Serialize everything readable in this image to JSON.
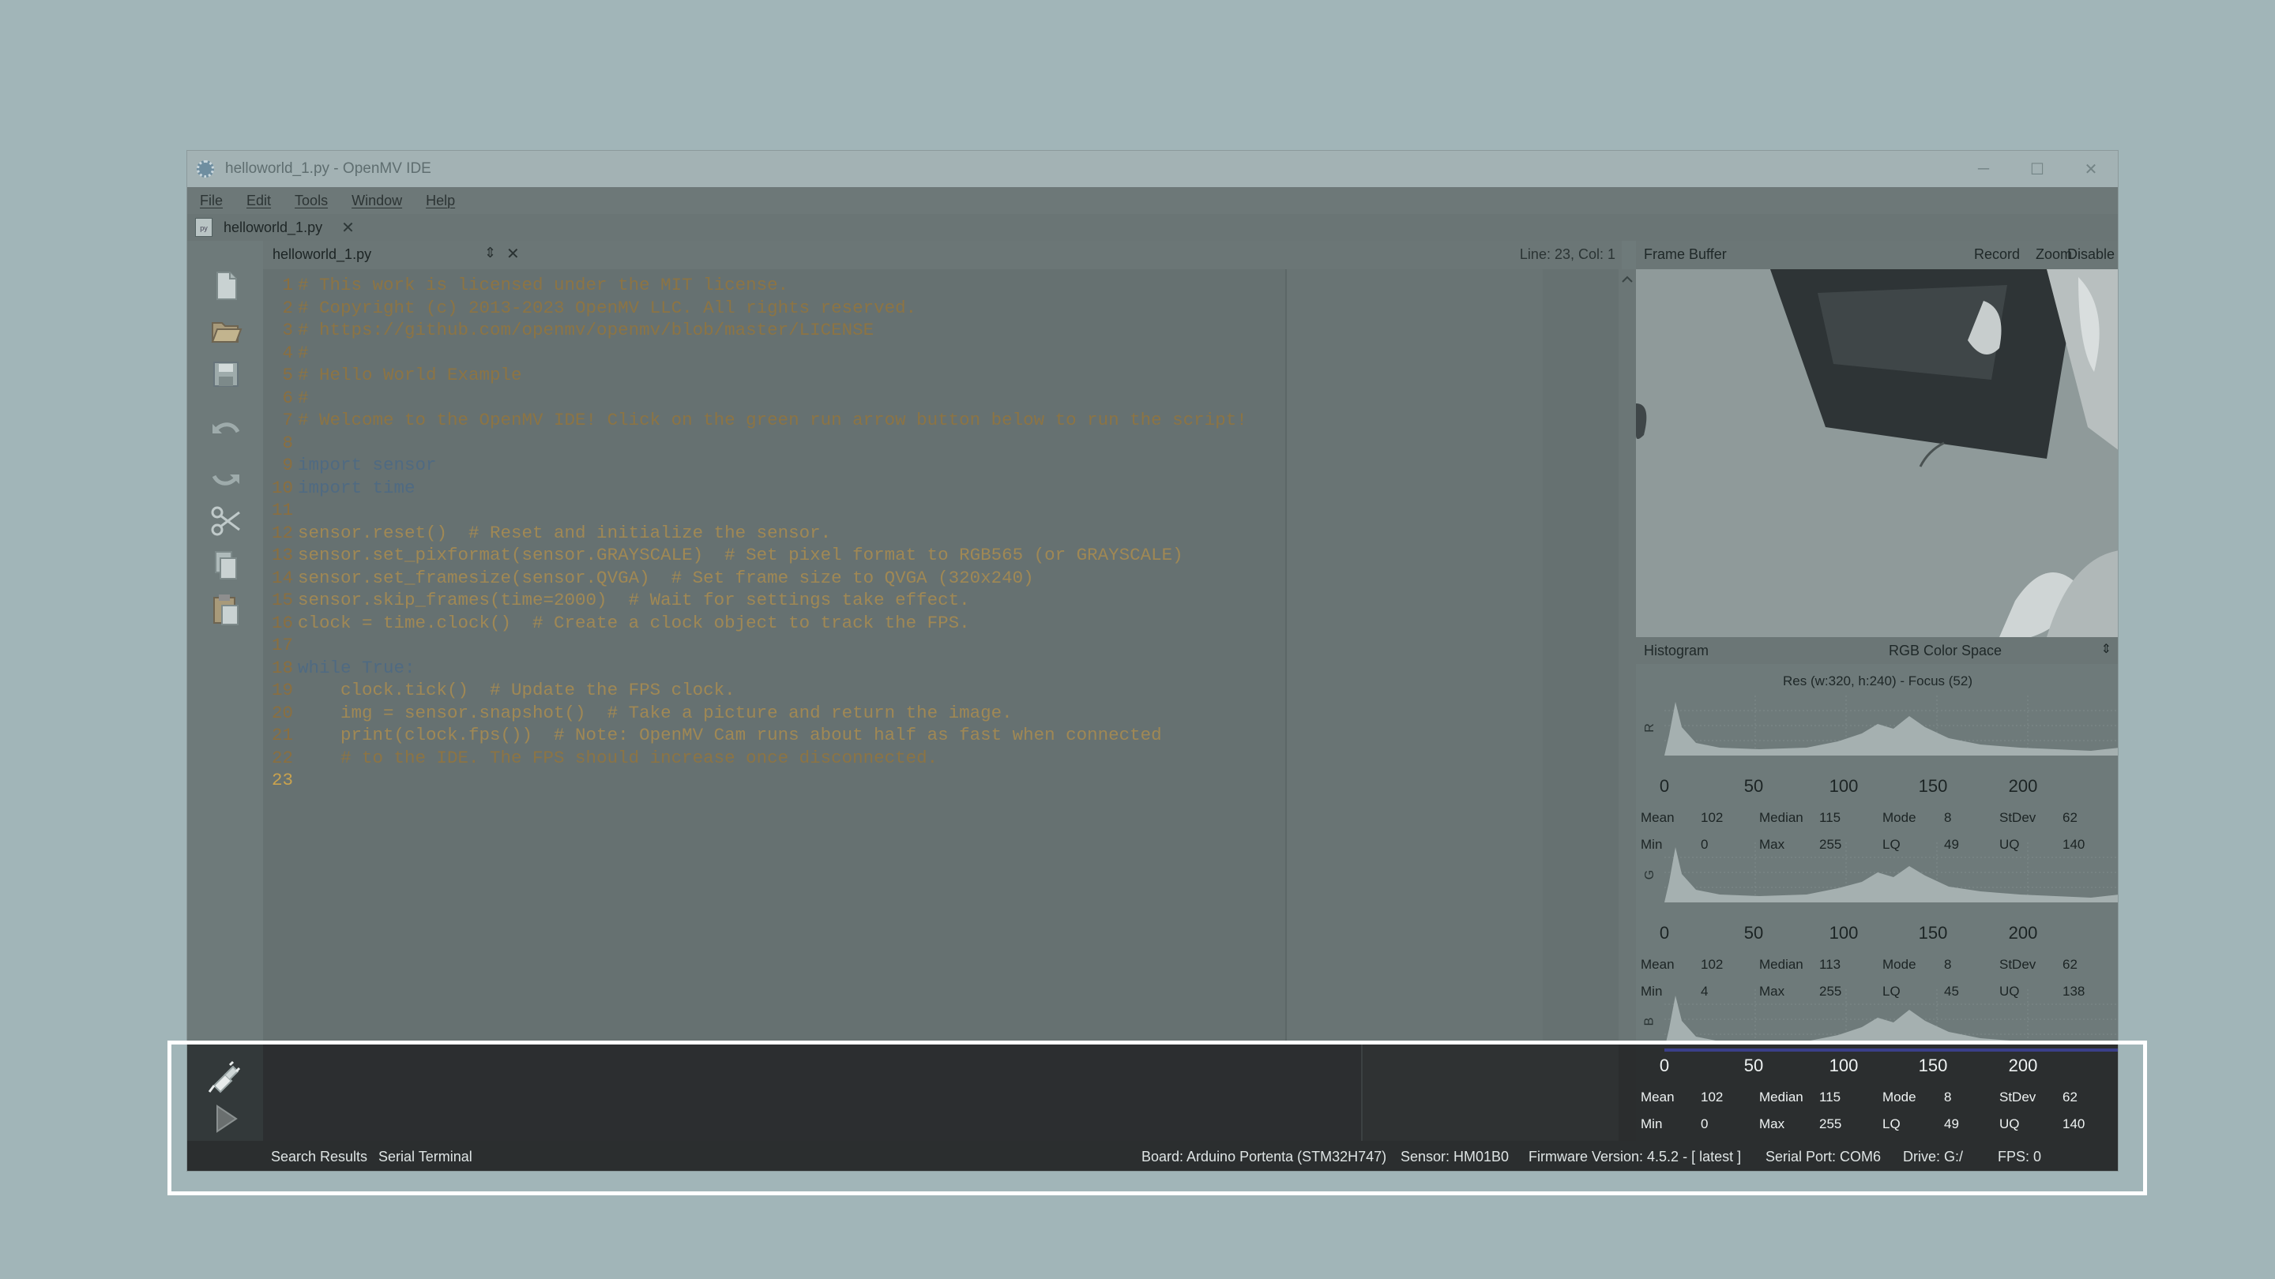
{
  "window": {
    "title": "helloworld_1.py - OpenMV IDE",
    "controls": [
      "─",
      "☐",
      "✕"
    ]
  },
  "menu": [
    "File",
    "Edit",
    "Tools",
    "Window",
    "Help"
  ],
  "file_tab": {
    "name": "helloworld_1.py",
    "close": "✕"
  },
  "editor": {
    "file_name": "helloworld_1.py",
    "arrows": "⇕",
    "close": "✕",
    "cursor_position": "Line: 23, Col: 1",
    "lines": [
      {
        "n": "1",
        "text": "# This work is licensed under the MIT license."
      },
      {
        "n": "2",
        "text": "# Copyright (c) 2013-2023 OpenMV LLC. All rights reserved."
      },
      {
        "n": "3",
        "text": "# https://github.com/openmv/openmv/blob/master/LICENSE"
      },
      {
        "n": "4",
        "text": "#"
      },
      {
        "n": "5",
        "text": "# Hello World Example"
      },
      {
        "n": "6",
        "text": "#"
      },
      {
        "n": "7",
        "text": "# Welcome to the OpenMV IDE! Click on the green run arrow button below to run the script!"
      },
      {
        "n": "8",
        "text": ""
      },
      {
        "n": "9",
        "text": "import sensor"
      },
      {
        "n": "10",
        "text": "import time"
      },
      {
        "n": "11",
        "text": ""
      },
      {
        "n": "12",
        "text": "sensor.reset()  # Reset and initialize the sensor."
      },
      {
        "n": "13",
        "text": "sensor.set_pixformat(sensor.GRAYSCALE)  # Set pixel format to RGB565 (or GRAYSCALE)"
      },
      {
        "n": "14",
        "text": "sensor.set_framesize(sensor.QVGA)  # Set frame size to QVGA (320x240)"
      },
      {
        "n": "15",
        "text": "sensor.skip_frames(time=2000)  # Wait for settings take effect."
      },
      {
        "n": "16",
        "text": "clock = time.clock()  # Create a clock object to track the FPS."
      },
      {
        "n": "17",
        "text": ""
      },
      {
        "n": "18",
        "text": "while True:"
      },
      {
        "n": "19",
        "text": "    clock.tick()  # Update the FPS clock."
      },
      {
        "n": "20",
        "text": "    img = sensor.snapshot()  # Take a picture and return the image."
      },
      {
        "n": "21",
        "text": "    print(clock.fps())  # Note: OpenMV Cam runs about half as fast when connected"
      },
      {
        "n": "22",
        "text": "    # to the IDE. The FPS should increase once disconnected."
      },
      {
        "n": "23",
        "text": ""
      }
    ]
  },
  "frame_buffer": {
    "label": "Frame Buffer",
    "record": "Record",
    "zoom": "Zoom",
    "disable": "Disable"
  },
  "histogram": {
    "label": "Histogram",
    "color_space": "RGB Color Space",
    "spinner": "⇕",
    "resolution": "Res (w:320, h:240) - Focus (52)",
    "ticks": [
      "0",
      "50",
      "100",
      "150",
      "200"
    ],
    "channels": [
      {
        "name": "R",
        "mean": "102",
        "median": "115",
        "mode": "8",
        "stdev": "62",
        "min": "0",
        "max": "255",
        "lq": "49",
        "uq": "140"
      },
      {
        "name": "G",
        "mean": "102",
        "median": "113",
        "mode": "8",
        "stdev": "62",
        "min": "4",
        "max": "255",
        "lq": "45",
        "uq": "138"
      },
      {
        "name": "B",
        "mean": "102",
        "median": "115",
        "mode": "8",
        "stdev": "62",
        "min": "0",
        "max": "255",
        "lq": "49",
        "uq": "140"
      }
    ],
    "stat_labels": {
      "mean": "Mean",
      "median": "Median",
      "mode": "Mode",
      "stdev": "StDev",
      "min": "Min",
      "max": "Max",
      "lq": "LQ",
      "uq": "UQ"
    }
  },
  "bottom_tabs": {
    "search": "Search Results",
    "serial": "Serial Terminal"
  },
  "status": {
    "board": "Board: Arduino Portenta (STM32H747)",
    "sensor": "Sensor: HM01B0",
    "firmware": "Firmware Version: 4.5.2 - [ latest ]",
    "serial_port": "Serial Port: COM6",
    "drive": "Drive: G:/",
    "fps": "FPS: 0"
  }
}
